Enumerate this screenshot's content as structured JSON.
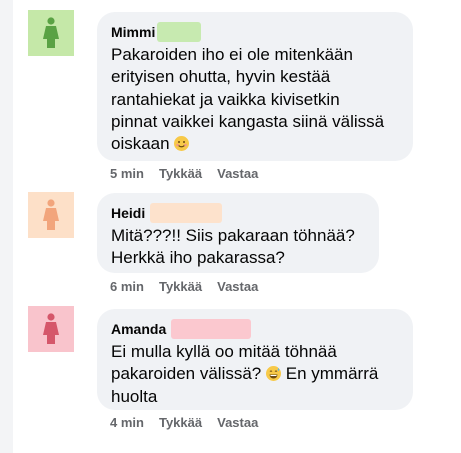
{
  "comments": [
    {
      "name": "Mimmi",
      "avatar_bg": "#c5e8a8",
      "figure_color": "#5aa244",
      "redact_color": "#c7eab0",
      "text": "Pakaroiden iho ei ole mitenkään\nerityisen ohutta, hyvin kestää\nrantahiekat ja vaikka kivisetkin\npinnat vaikkei kangasta siinä välissä\noiskaan",
      "emoji_icon": "smiling-face-icon",
      "time": "5 min",
      "like": "Tykkää",
      "reply": "Vastaa"
    },
    {
      "name": "Heidi",
      "avatar_bg": "#fde0c8",
      "figure_color": "#f2a57c",
      "redact_color": "#fde2cc",
      "text": "Mitä???!! Siis pakaraan töhnää?\nHerkkä iho pakarassa?",
      "time": "6 min",
      "like": "Tykkää",
      "reply": "Vastaa"
    },
    {
      "name": "Amanda",
      "avatar_bg": "#f9c4cc",
      "figure_color": "#d5576a",
      "redact_color": "#fbc8cf",
      "text": "Ei mulla kyllä oo mitää töhnää\npakaroiden välissä?",
      "text_after": "En ymmärrä\nhuolta",
      "emoji_icon": "grinning-sweat-face-icon",
      "time": "4 min",
      "like": "Tykkää",
      "reply": "Vastaa"
    }
  ]
}
